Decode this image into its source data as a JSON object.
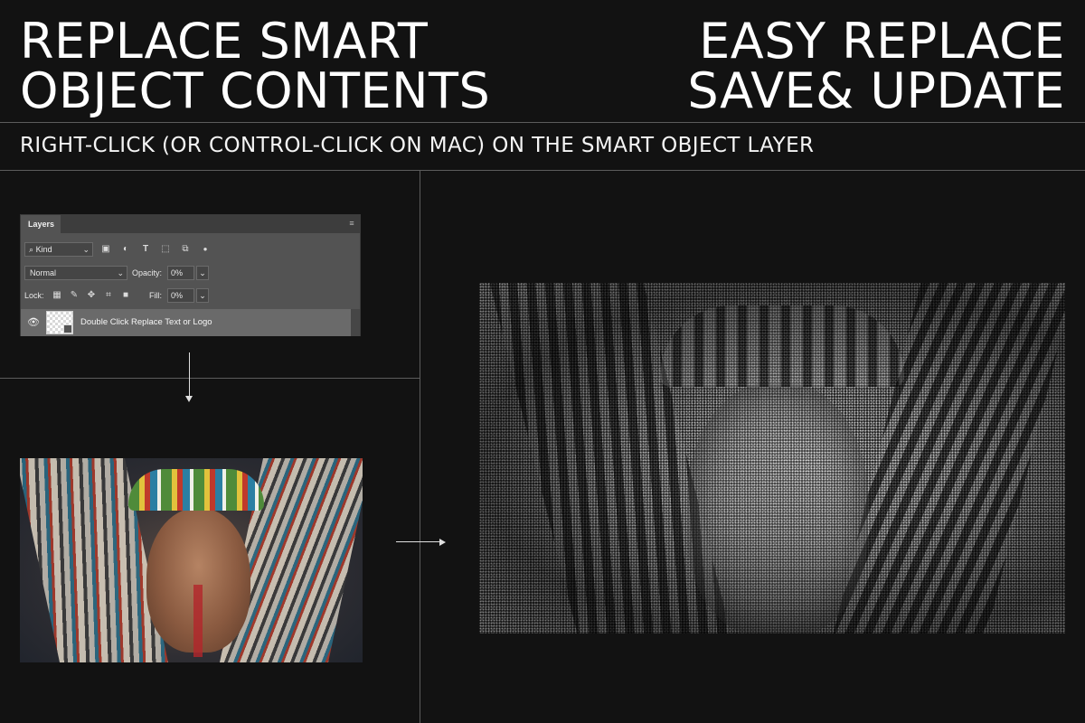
{
  "headline_left": {
    "line1": "REPLACE SMART",
    "line2": "OBJECT CONTENTS"
  },
  "headline_right": {
    "line1": "EASY REPLACE",
    "line2": "SAVE& UPDATE"
  },
  "subtitle": "RIGHT-CLICK (OR CONTROL-CLICK ON MAC) ON THE SMART OBJECT LAYER",
  "layers_panel": {
    "tab_label": "Layers",
    "kind_filter": "Kind",
    "blend_mode": "Normal",
    "opacity_label": "Opacity:",
    "opacity_value": "0%",
    "lock_label": "Lock:",
    "fill_label": "Fill:",
    "fill_value": "0%",
    "layer_name": "Double Click Replace Text or Logo"
  },
  "colors": {
    "background": "#121212",
    "panel": "#535353",
    "text": "#ffffff",
    "rule": "#5c5c5c"
  },
  "icons": {
    "panel_menu": "menu-lines-icon",
    "search": "search-icon",
    "visibility": "eye-icon",
    "filters": [
      "image-filter-icon",
      "adjustment-filter-icon",
      "type-filter-icon",
      "shape-filter-icon",
      "smart-object-filter-icon",
      "toggle-filter-icon"
    ],
    "locks": [
      "lock-transparent-icon",
      "lock-brush-icon",
      "lock-move-icon",
      "lock-artboard-icon",
      "lock-all-icon"
    ]
  }
}
